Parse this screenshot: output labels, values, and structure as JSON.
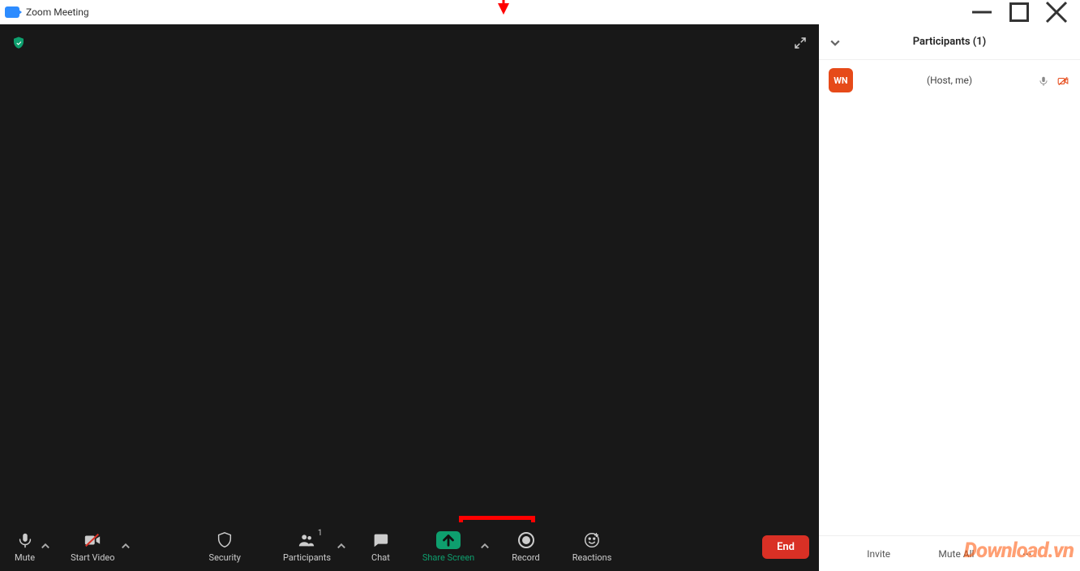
{
  "window": {
    "title": "Zoom Meeting"
  },
  "toolbar": {
    "mute": "Mute",
    "start_video": "Start Video",
    "security": "Security",
    "participants": "Participants",
    "participants_count": "1",
    "chat": "Chat",
    "share_screen": "Share Screen",
    "record": "Record",
    "reactions": "Reactions",
    "end": "End"
  },
  "panel": {
    "title": "Participants (1)",
    "rows": [
      {
        "avatar": "WN",
        "label": "(Host, me)"
      }
    ],
    "invite": "Invite",
    "mute_all": "Mute All"
  },
  "watermark": "Download.vn"
}
